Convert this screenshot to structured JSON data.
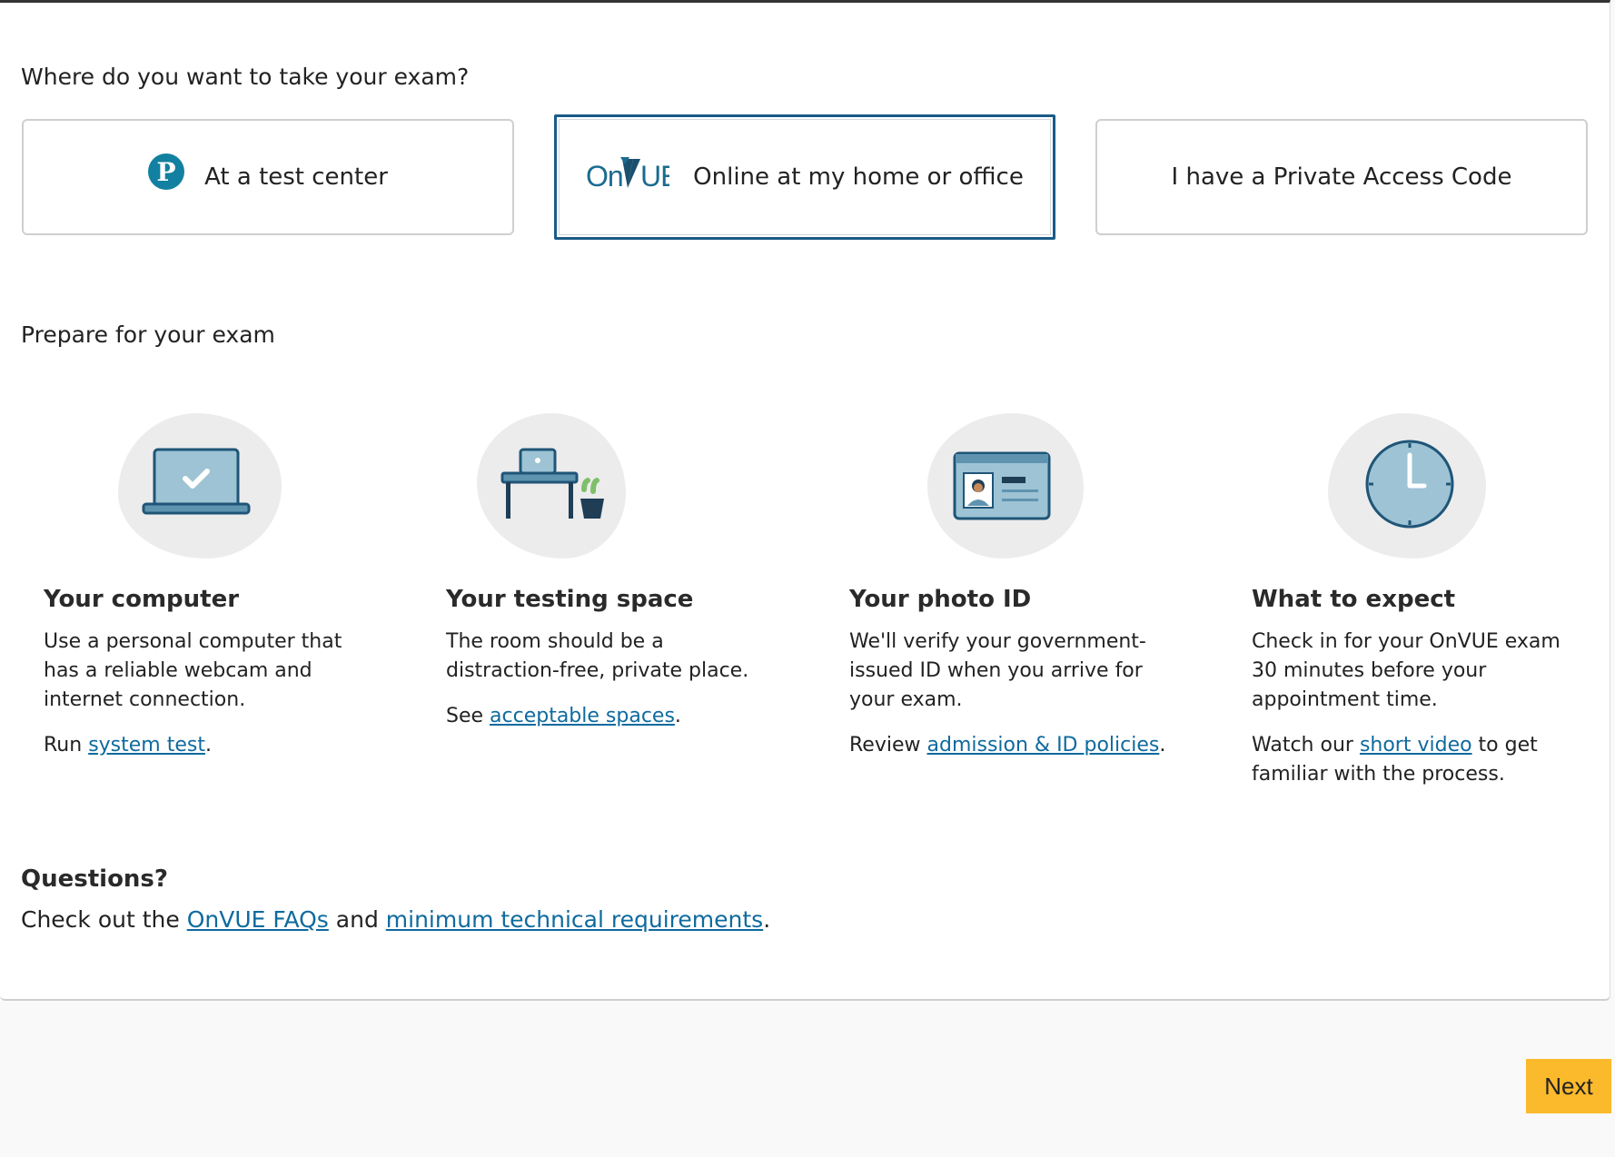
{
  "location": {
    "question": "Where do you want to take your exam?",
    "options": [
      {
        "label": "At a test center",
        "icon": "pearson-logo-icon",
        "selected": false
      },
      {
        "label": "Online at my home or office",
        "logo": "OnVUE",
        "selected": true
      },
      {
        "label": "I have a Private Access Code",
        "selected": false
      }
    ]
  },
  "prepare": {
    "heading": "Prepare for your exam",
    "tiles": [
      {
        "icon": "laptop-check-icon",
        "title": "Your computer",
        "text": "Use a personal computer that has a reliable webcam and internet connection.",
        "pre": "Run ",
        "link": "system test",
        "post": "."
      },
      {
        "icon": "desk-icon",
        "title": "Your testing space",
        "text": "The room should be a distraction-free, private place.",
        "pre": "See ",
        "link": "acceptable spaces",
        "post": "."
      },
      {
        "icon": "id-card-icon",
        "title": "Your photo ID",
        "text": "We'll verify your government-issued ID when you arrive for your exam.",
        "pre": "Review ",
        "link": "admission & ID policies",
        "post": "."
      },
      {
        "icon": "clock-icon",
        "title": "What to expect",
        "text": "Check in for your OnVUE exam 30 minutes before your appointment time.",
        "pre": "Watch our ",
        "link": "short video",
        "post": " to get familiar with the process."
      }
    ]
  },
  "questions": {
    "heading": "Questions?",
    "pre": "Check out the ",
    "link1": "OnVUE FAQs",
    "mid": " and ",
    "link2": "minimum technical requirements",
    "post": "."
  },
  "footer": {
    "next_label": "Next"
  },
  "colors": {
    "accent": "#1a5b87",
    "link": "#0f6a9e",
    "next_button": "#fbb92c",
    "icon_fill": "#9dc3d4",
    "icon_stroke": "#1f5577"
  }
}
